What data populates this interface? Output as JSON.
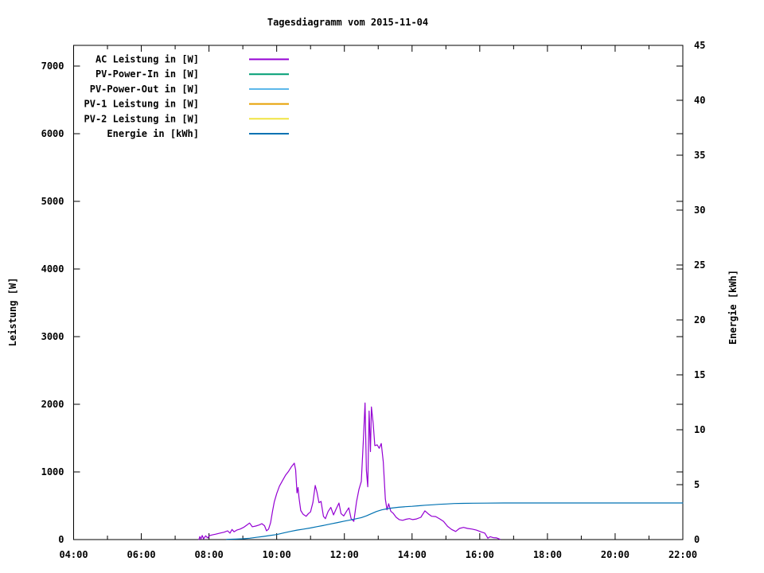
{
  "title": "Tagesdiagramm vom 2015-11-04",
  "chart_data": {
    "type": "line",
    "title": "Tagesdiagramm vom 2015-11-04",
    "grid": false,
    "legend_position": "top-left-inside",
    "x_axis": {
      "min_hour": 4,
      "max_hour": 22,
      "major_step_hours": 2,
      "minor_step_hours": 1,
      "tick_labels": [
        "04:00",
        "06:00",
        "08:00",
        "10:00",
        "12:00",
        "14:00",
        "16:00",
        "18:00",
        "20:00",
        "22:00"
      ]
    },
    "y1_axis": {
      "label": "Leistung [W]",
      "ticks": [
        0,
        1000,
        2000,
        3000,
        4000,
        5000,
        6000,
        7000
      ],
      "max": 7306
    },
    "y2_axis": {
      "label": "Energie [kWh]",
      "ticks": [
        0,
        5,
        10,
        15,
        20,
        25,
        30,
        35,
        40,
        45
      ],
      "max": 45
    },
    "series": [
      {
        "name": "AC Leistung in [W]",
        "color": "#9400D3",
        "axis": "y1",
        "points": [
          [
            7.7,
            0
          ],
          [
            7.73,
            45
          ],
          [
            7.76,
            8
          ],
          [
            7.8,
            60
          ],
          [
            7.84,
            12
          ],
          [
            7.9,
            55
          ],
          [
            7.96,
            25
          ],
          [
            8.02,
            60
          ],
          [
            8.1,
            70
          ],
          [
            8.2,
            80
          ],
          [
            8.32,
            95
          ],
          [
            8.45,
            110
          ],
          [
            8.55,
            130
          ],
          [
            8.62,
            95
          ],
          [
            8.68,
            150
          ],
          [
            8.74,
            115
          ],
          [
            8.82,
            140
          ],
          [
            8.92,
            155
          ],
          [
            9.02,
            180
          ],
          [
            9.12,
            215
          ],
          [
            9.2,
            245
          ],
          [
            9.28,
            190
          ],
          [
            9.38,
            200
          ],
          [
            9.48,
            215
          ],
          [
            9.56,
            235
          ],
          [
            9.64,
            205
          ],
          [
            9.7,
            130
          ],
          [
            9.76,
            155
          ],
          [
            9.82,
            250
          ],
          [
            9.88,
            430
          ],
          [
            9.93,
            560
          ],
          [
            10.0,
            680
          ],
          [
            10.08,
            790
          ],
          [
            10.17,
            870
          ],
          [
            10.26,
            950
          ],
          [
            10.35,
            1010
          ],
          [
            10.44,
            1080
          ],
          [
            10.52,
            1130
          ],
          [
            10.56,
            1030
          ],
          [
            10.6,
            690
          ],
          [
            10.63,
            770
          ],
          [
            10.66,
            620
          ],
          [
            10.71,
            430
          ],
          [
            10.78,
            375
          ],
          [
            10.87,
            345
          ],
          [
            10.94,
            385
          ],
          [
            11.0,
            410
          ],
          [
            11.07,
            550
          ],
          [
            11.14,
            800
          ],
          [
            11.19,
            700
          ],
          [
            11.25,
            545
          ],
          [
            11.31,
            565
          ],
          [
            11.38,
            345
          ],
          [
            11.44,
            310
          ],
          [
            11.52,
            415
          ],
          [
            11.6,
            475
          ],
          [
            11.68,
            365
          ],
          [
            11.76,
            455
          ],
          [
            11.84,
            540
          ],
          [
            11.9,
            385
          ],
          [
            11.98,
            350
          ],
          [
            12.06,
            415
          ],
          [
            12.13,
            470
          ],
          [
            12.2,
            310
          ],
          [
            12.28,
            270
          ],
          [
            12.36,
            560
          ],
          [
            12.43,
            740
          ],
          [
            12.5,
            860
          ],
          [
            12.56,
            1450
          ],
          [
            12.61,
            2020
          ],
          [
            12.65,
            1020
          ],
          [
            12.69,
            780
          ],
          [
            12.73,
            1900
          ],
          [
            12.77,
            1300
          ],
          [
            12.8,
            1960
          ],
          [
            12.85,
            1720
          ],
          [
            12.9,
            1390
          ],
          [
            12.97,
            1400
          ],
          [
            13.03,
            1350
          ],
          [
            13.09,
            1420
          ],
          [
            13.15,
            1150
          ],
          [
            13.21,
            600
          ],
          [
            13.26,
            440
          ],
          [
            13.31,
            530
          ],
          [
            13.37,
            420
          ],
          [
            13.44,
            390
          ],
          [
            13.53,
            330
          ],
          [
            13.62,
            295
          ],
          [
            13.72,
            285
          ],
          [
            13.82,
            300
          ],
          [
            13.92,
            310
          ],
          [
            14.02,
            295
          ],
          [
            14.13,
            305
          ],
          [
            14.26,
            330
          ],
          [
            14.38,
            425
          ],
          [
            14.48,
            380
          ],
          [
            14.58,
            345
          ],
          [
            14.7,
            340
          ],
          [
            14.82,
            305
          ],
          [
            14.93,
            270
          ],
          [
            15.05,
            195
          ],
          [
            15.17,
            150
          ],
          [
            15.29,
            120
          ],
          [
            15.4,
            165
          ],
          [
            15.52,
            180
          ],
          [
            15.64,
            165
          ],
          [
            15.77,
            155
          ],
          [
            15.9,
            140
          ],
          [
            16.03,
            115
          ],
          [
            16.15,
            95
          ],
          [
            16.24,
            20
          ],
          [
            16.31,
            42
          ],
          [
            16.4,
            28
          ],
          [
            16.5,
            25
          ],
          [
            16.6,
            3
          ]
        ]
      },
      {
        "name": "PV-Power-In in [W]",
        "color": "#009E73",
        "axis": "y1",
        "points": []
      },
      {
        "name": "PV-Power-Out in [W]",
        "color": "#56B4E9",
        "axis": "y1",
        "points": []
      },
      {
        "name": "PV-1 Leistung in [W]",
        "color": "#E69F00",
        "axis": "y1",
        "points": []
      },
      {
        "name": "PV-2 Leistung in [W]",
        "color": "#F0E442",
        "axis": "y1",
        "points": []
      },
      {
        "name": "Energie in [kWh]",
        "color": "#0072B2",
        "axis": "y2",
        "points": [
          [
            8.52,
            0.02
          ],
          [
            8.8,
            0.04
          ],
          [
            9.0,
            0.07
          ],
          [
            9.2,
            0.12
          ],
          [
            9.4,
            0.2
          ],
          [
            9.6,
            0.28
          ],
          [
            9.8,
            0.37
          ],
          [
            10.0,
            0.46
          ],
          [
            10.2,
            0.6
          ],
          [
            10.4,
            0.74
          ],
          [
            10.6,
            0.86
          ],
          [
            10.8,
            0.96
          ],
          [
            11.0,
            1.06
          ],
          [
            11.2,
            1.18
          ],
          [
            11.4,
            1.3
          ],
          [
            11.6,
            1.43
          ],
          [
            11.8,
            1.55
          ],
          [
            12.0,
            1.68
          ],
          [
            12.2,
            1.8
          ],
          [
            12.35,
            1.9
          ],
          [
            12.5,
            2.0
          ],
          [
            12.65,
            2.16
          ],
          [
            12.8,
            2.36
          ],
          [
            12.95,
            2.56
          ],
          [
            13.1,
            2.7
          ],
          [
            13.25,
            2.8
          ],
          [
            13.4,
            2.87
          ],
          [
            13.6,
            2.94
          ],
          [
            13.8,
            2.99
          ],
          [
            14.0,
            3.03
          ],
          [
            14.2,
            3.08
          ],
          [
            14.4,
            3.13
          ],
          [
            14.6,
            3.17
          ],
          [
            14.8,
            3.21
          ],
          [
            15.0,
            3.24
          ],
          [
            15.25,
            3.28
          ],
          [
            15.5,
            3.3
          ],
          [
            15.8,
            3.31
          ],
          [
            16.2,
            3.32
          ],
          [
            16.7,
            3.33
          ],
          [
            17.5,
            3.33
          ],
          [
            18.5,
            3.33
          ],
          [
            19.5,
            3.33
          ],
          [
            20.5,
            3.33
          ],
          [
            21.5,
            3.33
          ],
          [
            22.0,
            3.33
          ]
        ]
      }
    ],
    "colors": {
      "background": "#ffffff",
      "axis": "#000000",
      "text": "#000000"
    }
  }
}
